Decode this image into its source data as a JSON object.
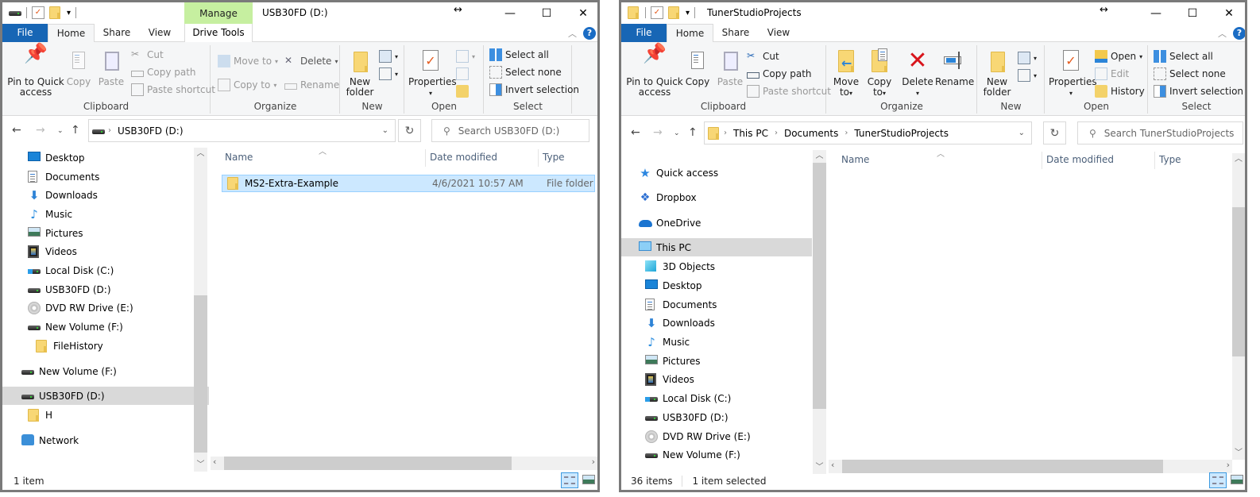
{
  "windowA": {
    "title": "USB30FD (D:)",
    "contextual_tab_group": "Manage",
    "tabs": [
      {
        "label": "File"
      },
      {
        "label": "Home",
        "active": true
      },
      {
        "label": "Share"
      },
      {
        "label": "View"
      },
      {
        "label": "Drive Tools"
      }
    ],
    "ribbon": {
      "clipboard": {
        "label": "Clipboard",
        "pin": "Pin to Quick access",
        "pin_line1": "Pin to Quick",
        "pin_line2": "access",
        "copy": "Copy",
        "paste": "Paste",
        "cut": "Cut",
        "copy_path": "Copy path",
        "paste_shortcut": "Paste shortcut"
      },
      "organize": {
        "label": "Organize",
        "move_to": "Move to",
        "copy_to": "Copy to",
        "delete": "Delete",
        "rename": "Rename"
      },
      "new": {
        "label": "New",
        "new_folder_line1": "New",
        "new_folder_line2": "folder"
      },
      "open": {
        "label": "Open",
        "properties": "Properties"
      },
      "select": {
        "label": "Select",
        "select_all": "Select all",
        "select_none": "Select none",
        "invert_selection": "Invert selection"
      }
    },
    "address": {
      "crumbs": [
        "USB30FD (D:)"
      ]
    },
    "search_placeholder": "Search USB30FD (D:)",
    "nav_items": [
      {
        "label": "Desktop",
        "icon": "desktop-icon"
      },
      {
        "label": "Documents",
        "icon": "documents-icon"
      },
      {
        "label": "Downloads",
        "icon": "downloads-icon"
      },
      {
        "label": "Music",
        "icon": "music-icon"
      },
      {
        "label": "Pictures",
        "icon": "pictures-icon"
      },
      {
        "label": "Videos",
        "icon": "videos-icon"
      },
      {
        "label": "Local Disk (C:)",
        "icon": "local-disk-icon"
      },
      {
        "label": "USB30FD (D:)",
        "icon": "drive-icon"
      },
      {
        "label": "DVD RW Drive (E:)",
        "icon": "dvd-drive-icon"
      },
      {
        "label": "New Volume (F:)",
        "icon": "drive-icon"
      },
      {
        "label": "FileHistory",
        "icon": "folder-icon"
      },
      {
        "label": "New Volume (F:)",
        "icon": "drive-icon"
      },
      {
        "label": "USB30FD (D:)",
        "icon": "drive-icon",
        "selected": true
      },
      {
        "label": "H",
        "icon": "folder-icon"
      },
      {
        "label": "Network",
        "icon": "network-icon"
      }
    ],
    "columns": [
      "Name",
      "Date modified",
      "Type"
    ],
    "files": [
      {
        "name": "MS2-Extra-Example",
        "date": "4/6/2021 10:57 AM",
        "type": "File folder",
        "selected": true
      }
    ],
    "status": {
      "count": "1 item"
    }
  },
  "windowB": {
    "title": "TunerStudioProjects",
    "tabs": [
      {
        "label": "File"
      },
      {
        "label": "Home",
        "active": true
      },
      {
        "label": "Share"
      },
      {
        "label": "View"
      }
    ],
    "ribbon": {
      "clipboard": {
        "label": "Clipboard",
        "pin_line1": "Pin to Quick",
        "pin_line2": "access",
        "copy": "Copy",
        "paste": "Paste",
        "cut": "Cut",
        "copy_path": "Copy path",
        "paste_shortcut": "Paste shortcut"
      },
      "organize": {
        "label": "Organize",
        "move_line1": "Move",
        "move_line2": "to",
        "copy_line1": "Copy",
        "copy_line2": "to",
        "delete": "Delete",
        "rename": "Rename"
      },
      "new": {
        "label": "New",
        "new_folder_line1": "New",
        "new_folder_line2": "folder"
      },
      "open": {
        "label": "Open",
        "properties": "Properties",
        "open": "Open",
        "edit": "Edit",
        "history": "History"
      },
      "select": {
        "label": "Select",
        "select_all": "Select all",
        "select_none": "Select none",
        "invert_selection": "Invert selection"
      }
    },
    "address": {
      "crumbs": [
        "This PC",
        "Documents",
        "TunerStudioProjects"
      ]
    },
    "search_placeholder": "Search TunerStudioProjects",
    "nav_items": [
      {
        "label": "Quick access",
        "icon": "quick-access-icon"
      },
      {
        "label": "Dropbox",
        "icon": "dropbox-icon"
      },
      {
        "label": "OneDrive",
        "icon": "onedrive-icon"
      },
      {
        "label": "This PC",
        "icon": "this-pc-icon",
        "selected": true
      },
      {
        "label": "3D Objects",
        "icon": "3d-objects-icon"
      },
      {
        "label": "Desktop",
        "icon": "desktop-icon"
      },
      {
        "label": "Documents",
        "icon": "documents-icon"
      },
      {
        "label": "Downloads",
        "icon": "downloads-icon"
      },
      {
        "label": "Music",
        "icon": "music-icon"
      },
      {
        "label": "Pictures",
        "icon": "pictures-icon"
      },
      {
        "label": "Videos",
        "icon": "videos-icon"
      },
      {
        "label": "Local Disk (C:)",
        "icon": "local-disk-icon"
      },
      {
        "label": "USB30FD (D:)",
        "icon": "drive-icon"
      },
      {
        "label": "DVD RW Drive (E:)",
        "icon": "dvd-drive-icon"
      },
      {
        "label": "New Volume (F:)",
        "icon": "drive-icon"
      }
    ],
    "columns": [
      "Name",
      "Date modified",
      "Type"
    ],
    "files": [],
    "status": {
      "count": "36 items",
      "selected": "1 item selected"
    }
  },
  "colors": {
    "file_tab": "#1766b5",
    "manage_tab": "#c6efa0",
    "selection": "#cce8ff",
    "nav_selection": "#d9d9d9"
  }
}
